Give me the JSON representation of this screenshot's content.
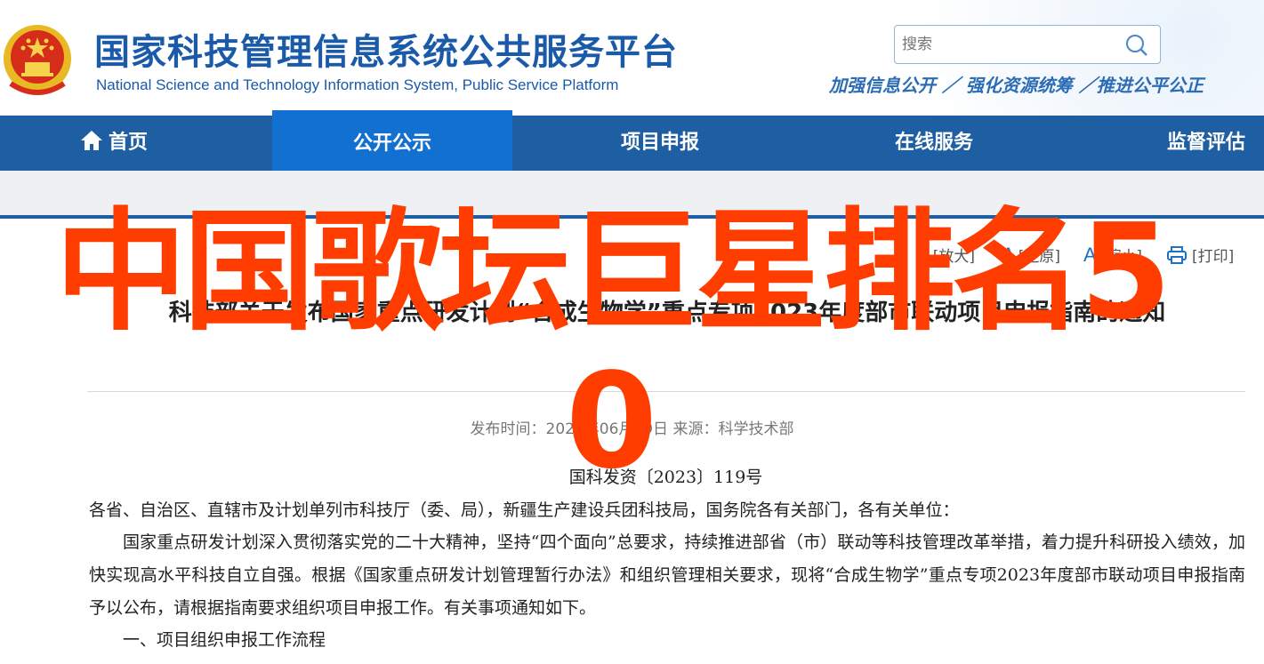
{
  "header": {
    "title": "国家科技管理信息系统公共服务平台",
    "subtitle": "National Science and Technology Information System, Public Service Platform",
    "search_placeholder": "搜索",
    "slogan": "加强信息公开 ／ 强化资源统筹 ／推进公平公正"
  },
  "nav": {
    "items": [
      {
        "label": "首页",
        "icon": "home-icon"
      },
      {
        "label": "公开公示",
        "active": true
      },
      {
        "label": "项目申报"
      },
      {
        "label": "在线服务"
      },
      {
        "label": "监督评估"
      }
    ]
  },
  "tools": {
    "enlarge": "[放大]",
    "restore": "[还原]",
    "shrink": "[缩小]",
    "print": "[打印]"
  },
  "article": {
    "title": "科技部关于发布国家重点研发计划“合成生物学”重点专项2023年度部市联动项目申报指南的通知",
    "meta": "发布时间：2023年06月29日 来源：科学技术部",
    "doc_number": "国科发资〔2023〕119号",
    "p1": "各省、自治区、直辖市及计划单列市科技厅（委、局），新疆生产建设兵团科技局，国务院各有关部门，各有关单位：",
    "p2": "国家重点研发计划深入贯彻落实党的二十大精神，坚持“四个面向”总要求，持续推进部省（市）联动等科技管理改革举措，着力提升科研投入绩效，加快实现高水平科技自立自强。根据《国家重点研发计划管理暂行办法》和组织管理相关要求，现将“合成生物学”重点专项2023年度部市联动项目申报指南予以公布，请根据指南要求组织项目申报工作。有关事项通知如下。",
    "p3": "一、项目组织申报工作流程"
  },
  "overlay": {
    "main": "中国歌坛巨星排名5",
    "tail": "0",
    "color": "#ff3d00"
  },
  "colors": {
    "nav_bg": "#1e5fa3",
    "nav_active": "#1170d0",
    "brand": "#1a5aa8"
  }
}
